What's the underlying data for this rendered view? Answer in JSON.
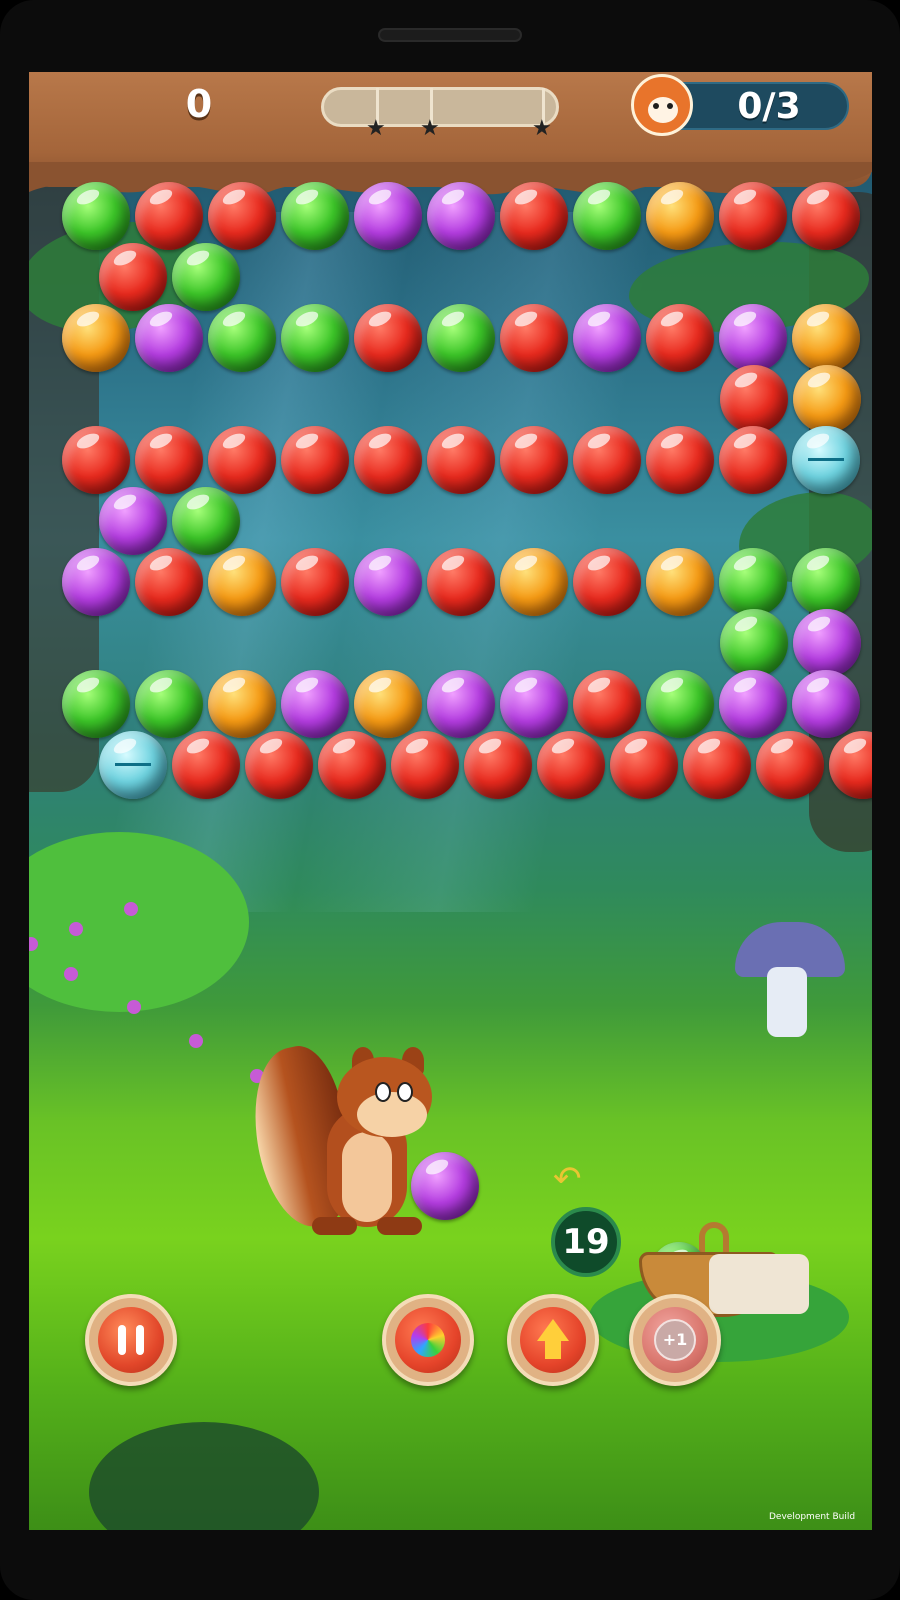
{
  "hud": {
    "score": "0",
    "goal_counter": "0/3",
    "goal_icon": "squirrel-face-icon",
    "progress_stars": [
      "star",
      "star",
      "star"
    ]
  },
  "shooter": {
    "loaded_bubble_color": "purple",
    "next_bubble_color": "green",
    "shots_remaining": "19"
  },
  "buttons": {
    "pause": "pause-icon",
    "rainbow_booster": "rainbow-swirl-icon",
    "up_booster": "up-arrow-icon",
    "plus_one_booster": "+1"
  },
  "board": {
    "bubbles": [
      {
        "row": 0,
        "col": 0,
        "color": "green"
      },
      {
        "row": 0,
        "col": 1,
        "color": "red"
      },
      {
        "row": 0,
        "col": 2,
        "color": "red"
      },
      {
        "row": 0,
        "col": 3,
        "color": "green"
      },
      {
        "row": 0,
        "col": 4,
        "color": "purple"
      },
      {
        "row": 0,
        "col": 5,
        "color": "purple"
      },
      {
        "row": 0,
        "col": 6,
        "color": "red"
      },
      {
        "row": 0,
        "col": 7,
        "color": "green"
      },
      {
        "row": 0,
        "col": 8,
        "color": "orange"
      },
      {
        "row": 0,
        "col": 9,
        "color": "red"
      },
      {
        "row": 0,
        "col": 10,
        "color": "red"
      },
      {
        "row": 1,
        "col": 0,
        "color": "red"
      },
      {
        "row": 1,
        "col": 1,
        "color": "green"
      },
      {
        "row": 2,
        "col": 0,
        "color": "orange"
      },
      {
        "row": 2,
        "col": 1,
        "color": "purple"
      },
      {
        "row": 2,
        "col": 2,
        "color": "green"
      },
      {
        "row": 2,
        "col": 3,
        "color": "green"
      },
      {
        "row": 2,
        "col": 4,
        "color": "red"
      },
      {
        "row": 2,
        "col": 5,
        "color": "green"
      },
      {
        "row": 2,
        "col": 6,
        "color": "red"
      },
      {
        "row": 2,
        "col": 7,
        "color": "purple"
      },
      {
        "row": 2,
        "col": 8,
        "color": "red"
      },
      {
        "row": 2,
        "col": 9,
        "color": "purple"
      },
      {
        "row": 2,
        "col": 10,
        "color": "orange"
      },
      {
        "row": 3,
        "col": 9,
        "color": "red"
      },
      {
        "row": 3,
        "col": 10,
        "color": "orange"
      },
      {
        "row": 4,
        "col": 0,
        "color": "red"
      },
      {
        "row": 4,
        "col": 1,
        "color": "red"
      },
      {
        "row": 4,
        "col": 2,
        "color": "red"
      },
      {
        "row": 4,
        "col": 3,
        "color": "red"
      },
      {
        "row": 4,
        "col": 4,
        "color": "red"
      },
      {
        "row": 4,
        "col": 5,
        "color": "red"
      },
      {
        "row": 4,
        "col": 6,
        "color": "red"
      },
      {
        "row": 4,
        "col": 7,
        "color": "red"
      },
      {
        "row": 4,
        "col": 8,
        "color": "red"
      },
      {
        "row": 4,
        "col": 9,
        "color": "red"
      },
      {
        "row": 4,
        "col": 10,
        "color": "special"
      },
      {
        "row": 5,
        "col": 0,
        "color": "purple"
      },
      {
        "row": 5,
        "col": 1,
        "color": "green"
      },
      {
        "row": 6,
        "col": 0,
        "color": "purple"
      },
      {
        "row": 6,
        "col": 1,
        "color": "red"
      },
      {
        "row": 6,
        "col": 2,
        "color": "orange"
      },
      {
        "row": 6,
        "col": 3,
        "color": "red"
      },
      {
        "row": 6,
        "col": 4,
        "color": "purple"
      },
      {
        "row": 6,
        "col": 5,
        "color": "red"
      },
      {
        "row": 6,
        "col": 6,
        "color": "orange"
      },
      {
        "row": 6,
        "col": 7,
        "color": "red"
      },
      {
        "row": 6,
        "col": 8,
        "color": "orange"
      },
      {
        "row": 6,
        "col": 9,
        "color": "green"
      },
      {
        "row": 6,
        "col": 10,
        "color": "green"
      },
      {
        "row": 7,
        "col": 9,
        "color": "green"
      },
      {
        "row": 7,
        "col": 10,
        "color": "purple"
      },
      {
        "row": 8,
        "col": 0,
        "color": "green"
      },
      {
        "row": 8,
        "col": 1,
        "color": "green"
      },
      {
        "row": 8,
        "col": 2,
        "color": "orange"
      },
      {
        "row": 8,
        "col": 3,
        "color": "purple"
      },
      {
        "row": 8,
        "col": 4,
        "color": "orange"
      },
      {
        "row": 8,
        "col": 5,
        "color": "purple"
      },
      {
        "row": 8,
        "col": 6,
        "color": "purple"
      },
      {
        "row": 8,
        "col": 7,
        "color": "red"
      },
      {
        "row": 8,
        "col": 8,
        "color": "green"
      },
      {
        "row": 8,
        "col": 9,
        "color": "purple"
      },
      {
        "row": 8,
        "col": 10,
        "color": "purple"
      },
      {
        "row": 9,
        "col": 0,
        "color": "special"
      },
      {
        "row": 9,
        "col": 1,
        "color": "red"
      },
      {
        "row": 9,
        "col": 2,
        "color": "red"
      },
      {
        "row": 9,
        "col": 3,
        "color": "red"
      },
      {
        "row": 9,
        "col": 4,
        "color": "red"
      },
      {
        "row": 9,
        "col": 5,
        "color": "red"
      },
      {
        "row": 9,
        "col": 6,
        "color": "red"
      },
      {
        "row": 9,
        "col": 7,
        "color": "red"
      },
      {
        "row": 9,
        "col": 8,
        "color": "red"
      },
      {
        "row": 9,
        "col": 9,
        "color": "red"
      },
      {
        "row": 9,
        "col": 10,
        "color": "red"
      }
    ]
  },
  "footer": {
    "build_label": "Development Build"
  }
}
